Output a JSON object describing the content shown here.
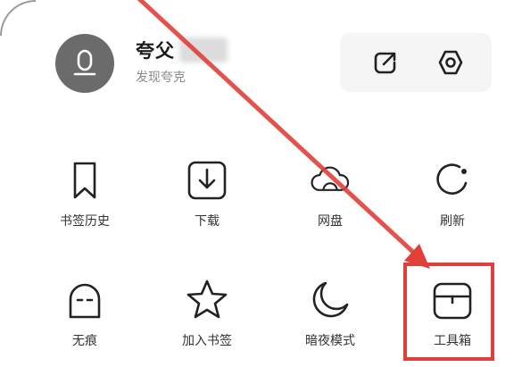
{
  "profile": {
    "name": "夸父",
    "subtitle": "发现夸克",
    "avatar_icon": "user-avatar-icon"
  },
  "actions": [
    {
      "icon": "share-icon"
    },
    {
      "icon": "settings-icon"
    }
  ],
  "grid": [
    {
      "label": "书签历史",
      "icon": "bookmark-history-icon"
    },
    {
      "label": "下载",
      "icon": "download-icon"
    },
    {
      "label": "网盘",
      "icon": "cloud-drive-icon"
    },
    {
      "label": "刷新",
      "icon": "refresh-icon"
    },
    {
      "label": "无痕",
      "icon": "incognito-icon"
    },
    {
      "label": "加入书签",
      "icon": "add-bookmark-icon"
    },
    {
      "label": "暗夜模式",
      "icon": "night-mode-icon"
    },
    {
      "label": "工具箱",
      "icon": "toolbox-icon"
    }
  ],
  "annotation": {
    "color": "#e0403a",
    "highlighted_item": "工具箱"
  }
}
